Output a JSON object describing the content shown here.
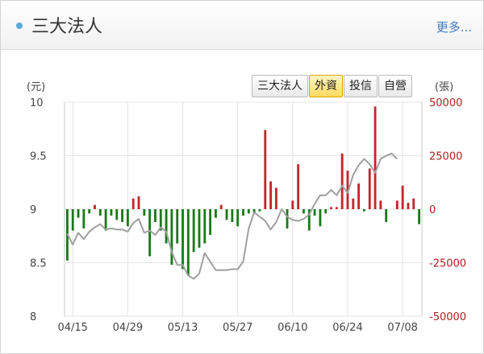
{
  "header": {
    "title": "三大法人",
    "more_label": "更多..."
  },
  "tabs": [
    {
      "label": "三大法人",
      "active": false
    },
    {
      "label": "外資",
      "active": true
    },
    {
      "label": "投信",
      "active": false
    },
    {
      "label": "自營",
      "active": false
    }
  ],
  "colors": {
    "positive": "#c0282d",
    "negative": "#1a7a1a",
    "price_line": "#a0a0a0",
    "accent": "#5aaad6"
  },
  "chart_data": {
    "type": "bar",
    "left_axis": {
      "unit": "(元)",
      "range": [
        8,
        10
      ],
      "ticks": [
        8,
        8.5,
        9,
        9.5,
        10
      ],
      "tick_labels": [
        "8",
        "8.5",
        "9",
        "9.5",
        "10"
      ]
    },
    "right_axis": {
      "unit": "(張)",
      "range": [
        -50000,
        50000
      ],
      "ticks": [
        -50000,
        -25000,
        0,
        25000,
        50000
      ],
      "tick_labels": [
        "-50000",
        "-25000",
        "0",
        "25000",
        "50000"
      ]
    },
    "x_tick_labels": [
      "04/15",
      "04/29",
      "05/13",
      "05/27",
      "06/10",
      "06/24",
      "07/08"
    ],
    "x_tick_index": [
      1,
      11,
      21,
      31,
      41,
      51,
      61
    ],
    "grid": true,
    "series": [
      {
        "type": "bar",
        "axis": "right",
        "values": [
          -24000,
          -10000,
          -4000,
          -9000,
          -2000,
          2000,
          -3000,
          -10000,
          -3000,
          -5000,
          -6000,
          -8000,
          5000,
          6000,
          -3000,
          -22000,
          -6000,
          -10000,
          -16000,
          -26000,
          -16000,
          -28000,
          -31000,
          -20000,
          -18000,
          -16000,
          -12000,
          -4000,
          2000,
          -5000,
          -6000,
          -8000,
          -3000,
          -2000,
          -2000,
          -1000,
          37000,
          13000,
          10000,
          0,
          -9000,
          4000,
          21000,
          -2000,
          -10000,
          -3000,
          -8000,
          -2000,
          1000,
          1000,
          26000,
          18000,
          5000,
          12000,
          -1000,
          19000,
          48000,
          4000,
          -6000,
          0,
          4000,
          11000,
          3000,
          5000,
          -7000
        ],
        "name": ""
      },
      {
        "type": "line",
        "axis": "left",
        "values": [
          8.77,
          8.67,
          8.78,
          8.72,
          8.79,
          8.83,
          8.86,
          8.81,
          8.82,
          8.81,
          8.81,
          8.79,
          8.87,
          8.91,
          8.78,
          8.8,
          8.76,
          8.83,
          8.79,
          8.6,
          8.48,
          8.48,
          8.38,
          8.35,
          8.4,
          8.59,
          8.51,
          8.43,
          8.43,
          8.43,
          8.44,
          8.44,
          8.51,
          8.82,
          8.97,
          8.93,
          8.89,
          8.81,
          8.88,
          9.0,
          8.93,
          8.9,
          8.89,
          8.91,
          8.95,
          9.05,
          9.13,
          9.13,
          9.18,
          9.13,
          9.22,
          9.15,
          9.32,
          9.41,
          9.47,
          9.42,
          9.34,
          9.47,
          9.5,
          9.52,
          9.47
        ],
        "name": ""
      }
    ]
  }
}
